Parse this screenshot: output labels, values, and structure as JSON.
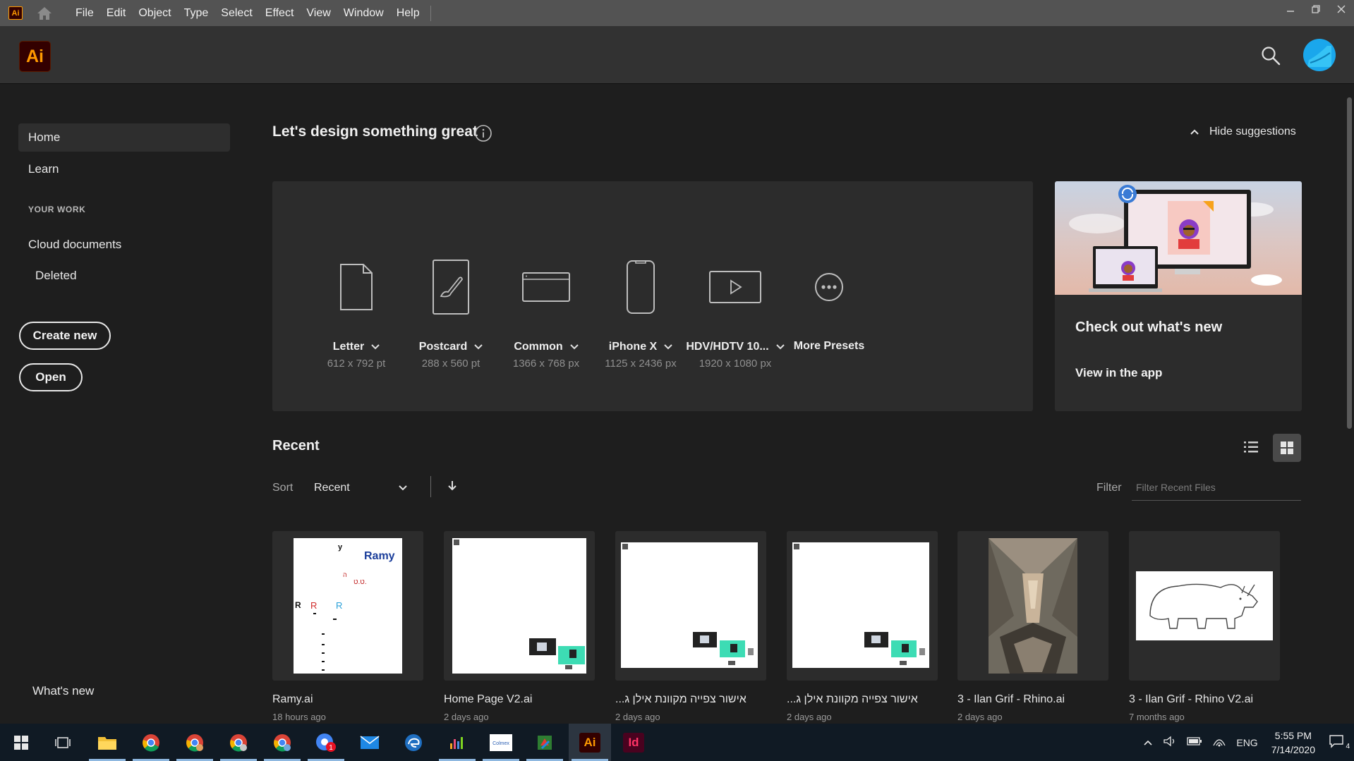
{
  "menubar": {
    "app_mini_label": "Ai",
    "items": [
      "File",
      "Edit",
      "Object",
      "Type",
      "Select",
      "Effect",
      "View",
      "Window",
      "Help"
    ]
  },
  "header": {
    "logo_label": "Ai"
  },
  "sidebar": {
    "home": "Home",
    "learn": "Learn",
    "your_work_heading": "YOUR WORK",
    "cloud_documents": "Cloud documents",
    "deleted": "Deleted",
    "create_new": "Create new",
    "open": "Open",
    "whats_new": "What's new"
  },
  "main": {
    "welcome": "Let's design something great",
    "hide_suggestions": "Hide suggestions",
    "presets": [
      {
        "name": "Letter",
        "size": "612 x 792 pt",
        "icon": "document-icon"
      },
      {
        "name": "Postcard",
        "size": "288 x 560 pt",
        "icon": "postcard-brush-icon"
      },
      {
        "name": "Common",
        "size": "1366 x 768 px",
        "icon": "browser-window-icon"
      },
      {
        "name": "iPhone X",
        "size": "1125 x 2436 px",
        "icon": "phone-icon"
      },
      {
        "name": "HDV/HDTV 10...",
        "size": "1920 x 1080 px",
        "icon": "video-play-icon"
      },
      {
        "name": "More Presets",
        "size": "",
        "icon": "more-icon"
      }
    ],
    "whats_new_card": {
      "title": "Check out what's new",
      "link": "View in the app"
    },
    "recent_title": "Recent",
    "sort_label": "Sort",
    "sort_value": "Recent",
    "filter_label": "Filter",
    "filter_placeholder": "Filter Recent Files",
    "files": [
      {
        "name": "Ramy.ai",
        "date": "18 hours ago"
      },
      {
        "name": "Home Page V2.ai",
        "date": "2 days ago"
      },
      {
        "name": "...אישור צפייה מקוונת אילן ג",
        "date": "2 days ago"
      },
      {
        "name": "...אישור צפייה מקוונת אילן ג",
        "date": "2 days ago"
      },
      {
        "name": "3 - Ilan Grif - Rhino.ai",
        "date": "2 days ago"
      },
      {
        "name": "3 - Ilan Grif - Rhino V2.ai",
        "date": "7 months ago"
      }
    ]
  },
  "taskbar": {
    "ai_label": "Ai",
    "id_label": "Id",
    "mail_badge": "1",
    "lang": "ENG",
    "time": "5:55 PM",
    "date": "7/14/2020",
    "notif_count": "4"
  },
  "colors": {
    "ai_orange": "#ff9a00",
    "ai_dark": "#330000",
    "accent_blue": "#1aa7ec"
  }
}
